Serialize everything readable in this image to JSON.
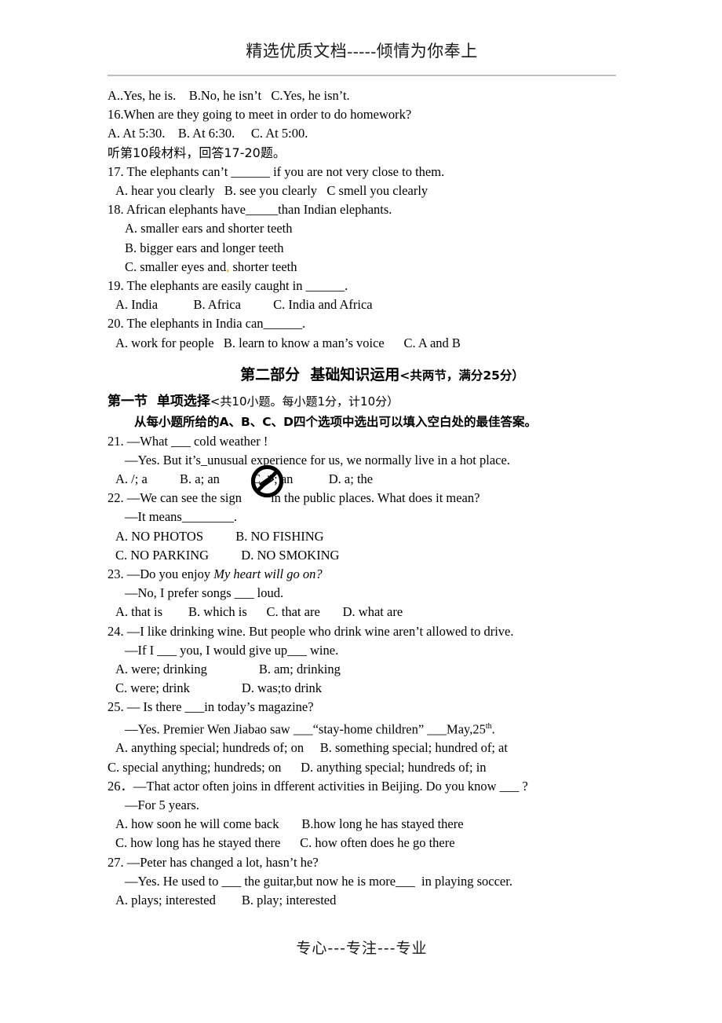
{
  "header": {
    "watermark": "精选优质文档-----倾情为你奉上"
  },
  "footer": {
    "slogan": "专心---专注---专业"
  },
  "listening": {
    "q15_options": "A..Yes, he is.    B.No, he isn’t   C.Yes, he isn’t.",
    "q16_stem": "16.When are they going to meet in order to do homework?",
    "q16_options": "A. At 5:30.    B. At 6:30.     C. At 5:00.",
    "material_note": "听第10段材料，回答17-20题。",
    "q17_stem": "17. The elephants can’t ______ if you are not very close to them.",
    "q17_options": "A. hear you clearly   B. see you clearly   C smell you clearly",
    "q18_stem": "18. African elephants have_____than Indian elephants.",
    "q18_a": "A. smaller ears and shorter teeth",
    "q18_b": "B. bigger ears and longer teeth",
    "q18_c_pre": "C. smaller eyes and",
    "q18_c_mark": ",",
    "q18_c_post": " shorter teeth",
    "q19_stem": "19. The elephants are easily caught in ______.",
    "q19_options": "A. India           B. Africa          C. India and Africa",
    "q20_stem": "20. The elephants in India can______.",
    "q20_options": "A. work for people   B. learn to know a man’s voice      C. A and B"
  },
  "part2": {
    "title_bold": "第二部分  基础知识运用",
    "title_small": "<共两节，满分25分）",
    "section1_bold": "第一节  单项选择",
    "section1_small": "<共10小题。每小题1分，计10分）",
    "instruction": "从每小题所给的A、B、C、D四个选项中选出可以填入空白处的最佳答案。"
  },
  "questions": {
    "q21": {
      "line1": "21. —What ___ cold weather !",
      "line2": "—Yes. But it’s_unusual experience for us, we normally live in a hot place.",
      "options": "A. /; a          B. a; an          C. / ; an           D. a; the"
    },
    "q22": {
      "line1_pre": "22. —We can see the sign ",
      "line1_post": "        in the public places. What does it mean?",
      "sign_icon": "no-smoking-sign",
      "line2": "—It means________.",
      "options_ab": "A. NO PHOTOS          B. NO FISHING",
      "options_cd": "C. NO PARKING          D. NO SMOKING"
    },
    "q23": {
      "line1_pre": "23. —Do you enjoy ",
      "line1_italic": "My heart will go on?",
      "line2": "—No, I prefer songs ___ loud.",
      "options": "A. that is        B. which is      C. that are       D. what are"
    },
    "q24": {
      "line1": "24. —I like drinking wine. But people who drink wine aren’t allowed to drive.",
      "line2": "—If I ___ you, I would give up___ wine.",
      "options_ab": "A. were; drinking                B. am; drinking",
      "options_cd": "C. were; drink                D. was;to drink"
    },
    "q25": {
      "line1": "25. — Is there ___in today’s magazine?",
      "line2_pre": "—Yes. Premier Wen Jiabao saw ___“stay-home children” ___May,25",
      "line2_sup": "th",
      "line2_post": ".",
      "options_ab": "A. anything special; hundreds of; on     B. something special; hundred of; at",
      "options_cd": "C. special anything; hundreds; on      D. anything special; hundreds of; in"
    },
    "q26": {
      "line1": "26．—That actor often joins in dfferent activities in Beijing. Do you know ___ ?",
      "line2": "—For 5 years.",
      "options_ab": "A. how soon he will come back       B.how long he has stayed there",
      "options_cd": "C. how long has he stayed there      C. how often does he go there"
    },
    "q27": {
      "line1": "27. —Peter has changed a lot, hasn’t he?",
      "line2": "—Yes. He used to ___ the guitar,but now he is more___  in playing soccer.",
      "options": "A. plays; interested        B. play; interested"
    }
  }
}
